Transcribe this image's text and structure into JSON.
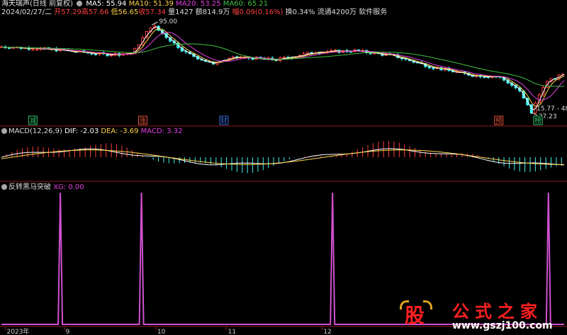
{
  "header": {
    "name": "海天瑞声",
    "mode": "(日线 前复权)",
    "ma5_label": "MA5: 55.94",
    "ma10_label": "MA10: 51.39",
    "ma20_label": "MA20: 53.25",
    "ma60_label": "MA60: 65.21",
    "date": "2024/02/27/二",
    "open": "开57.29",
    "high": "高57.66",
    "low": "低56.65",
    "close": "收57.34",
    "volume": "量1427",
    "amount": "额814.9万",
    "change": "幅0.09(0.16%)",
    "turnover": "换0.34%",
    "float": "流通4200万",
    "sector": "软件服务"
  },
  "annotations": {
    "high_price": "95.00",
    "low_price": "27.23",
    "right_price": "15.77 - 48"
  },
  "markers": [
    {
      "label": "减",
      "color": "#2ec26a",
      "day": 24
    },
    {
      "label": "涨",
      "color": "#e0503a",
      "day": 108
    },
    {
      "label": "财",
      "color": "#3a6ad8",
      "day": 170
    },
    {
      "label": "预",
      "color": "#e0503a",
      "day": 380
    },
    {
      "label": "榜",
      "color": "#2ec26a",
      "day": 410
    }
  ],
  "macd_header": {
    "title": "MACD(12,26,9)",
    "dif": "DIF: -2.03",
    "dea": "DEA: -3.69",
    "macd": "MACD: 3.32"
  },
  "signal_header": {
    "title": "反转黑马突破",
    "xg": "XG: 0.00"
  },
  "x_axis": [
    {
      "label": "2023年",
      "day": 3
    },
    {
      "label": "9",
      "day": 48
    },
    {
      "label": "10",
      "day": 118
    },
    {
      "label": "11",
      "day": 172
    },
    {
      "label": "12",
      "day": 245
    }
  ],
  "watermark": {
    "brand": "股",
    "title": "公式之家",
    "url": "www.gszj100.com"
  },
  "colors": {
    "ma5": "#ffffff",
    "ma10": "#ffd34a",
    "ma20": "#e040e0",
    "ma60": "#40c040",
    "up": "#ff3c3c",
    "down": "#40f0f0",
    "signal": "#d050d0"
  },
  "chart_data": [
    {
      "type": "candlestick",
      "title": "海天瑞声 (日线 前复权)",
      "ylim": [
        20,
        100
      ],
      "series": [
        {
          "name": "MA5",
          "last": 55.94
        },
        {
          "name": "MA10",
          "last": 51.39
        },
        {
          "name": "MA20",
          "last": 53.25
        },
        {
          "name": "MA60",
          "last": 65.21
        }
      ],
      "points": [
        {
          "day": 0,
          "close": 78
        },
        {
          "day": 40,
          "close": 76
        },
        {
          "day": 80,
          "close": 72
        },
        {
          "day": 100,
          "close": 73
        },
        {
          "day": 115,
          "close": 95
        },
        {
          "day": 140,
          "close": 74
        },
        {
          "day": 160,
          "close": 65
        },
        {
          "day": 180,
          "close": 70
        },
        {
          "day": 210,
          "close": 68
        },
        {
          "day": 240,
          "close": 74
        },
        {
          "day": 270,
          "close": 75
        },
        {
          "day": 300,
          "close": 71
        },
        {
          "day": 330,
          "close": 62
        },
        {
          "day": 360,
          "close": 56
        },
        {
          "day": 380,
          "close": 55
        },
        {
          "day": 395,
          "close": 45
        },
        {
          "day": 405,
          "close": 27.23
        },
        {
          "day": 415,
          "close": 50
        },
        {
          "day": 430,
          "close": 57.34
        }
      ]
    },
    {
      "type": "line",
      "title": "MACD(12,26,9)",
      "ylim": [
        -8,
        8
      ],
      "series": [
        {
          "name": "DIF",
          "last": -2.03
        },
        {
          "name": "DEA",
          "last": -3.69
        },
        {
          "name": "MACD",
          "last": 3.32
        }
      ]
    },
    {
      "type": "line",
      "title": "反转黑马突破",
      "ylim": [
        0,
        1
      ],
      "series": [
        {
          "name": "XG",
          "last": 0.0
        }
      ],
      "signal_days": [
        45,
        107,
        253,
        418
      ]
    }
  ]
}
